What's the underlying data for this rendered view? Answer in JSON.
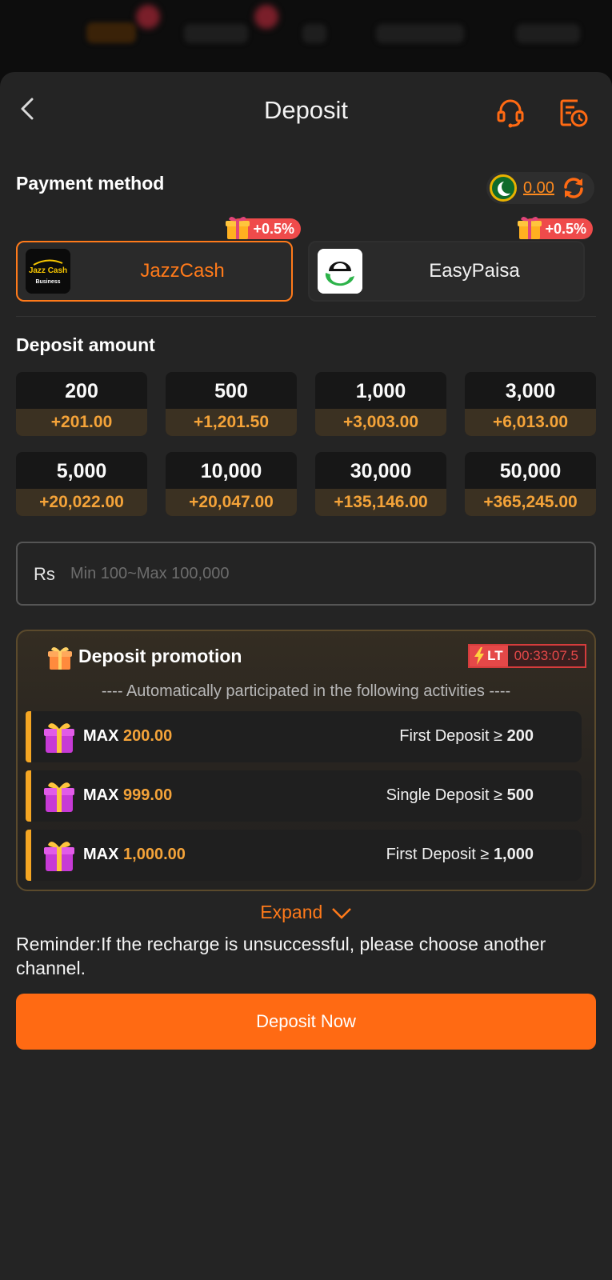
{
  "header": {
    "title": "Deposit"
  },
  "payment": {
    "section_title": "Payment method",
    "balance": "0.00",
    "methods": [
      {
        "name": "JazzCash",
        "bonus": "+0.5%",
        "logo_text_1": "Jazz Cash",
        "logo_text_2": "Business"
      },
      {
        "name": "EasyPaisa",
        "bonus": "+0.5%"
      }
    ]
  },
  "deposit": {
    "section_title": "Deposit amount",
    "amounts": [
      {
        "amount": "200",
        "bonus": "+201.00"
      },
      {
        "amount": "500",
        "bonus": "+1,201.50"
      },
      {
        "amount": "1,000",
        "bonus": "+3,003.00"
      },
      {
        "amount": "3,000",
        "bonus": "+6,013.00"
      },
      {
        "amount": "5,000",
        "bonus": "+20,022.00"
      },
      {
        "amount": "10,000",
        "bonus": "+20,047.00"
      },
      {
        "amount": "30,000",
        "bonus": "+135,146.00"
      },
      {
        "amount": "50,000",
        "bonus": "+365,245.00"
      }
    ],
    "currency_prefix": "Rs",
    "input_placeholder": "Min 100~Max 100,000"
  },
  "promotion": {
    "title": "Deposit promotion",
    "timer_label": "LT",
    "timer_value": "00:33:07.5",
    "subtitle": "---- Automatically participated in the following activities ----",
    "activities": [
      {
        "max_label": "MAX",
        "max_value": "200.00",
        "cond_label": "First Deposit ≥",
        "cond_value": "200"
      },
      {
        "max_label": "MAX",
        "max_value": "999.00",
        "cond_label": "Single Deposit ≥",
        "cond_value": "500"
      },
      {
        "max_label": "MAX",
        "max_value": "1,000.00",
        "cond_label": "First Deposit ≥",
        "cond_value": "1,000"
      }
    ],
    "expand_label": "Expand"
  },
  "reminder": "Reminder:If the recharge is unsuccessful, please choose another channel.",
  "action": {
    "deposit_now": "Deposit Now"
  },
  "colors": {
    "accent": "#ff6a13",
    "bonus_text": "#f4a339",
    "badge": "#ef4b4b"
  }
}
